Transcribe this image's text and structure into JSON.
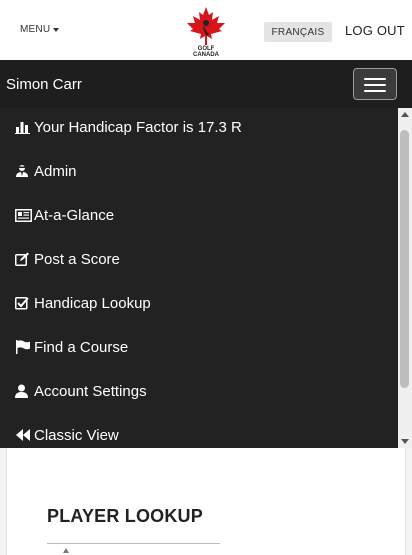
{
  "header": {
    "menu_label": "MENU",
    "logo_text_line1": "GOLF",
    "logo_text_line2": "CANADA",
    "language_button": "FRANÇAIS",
    "logout_label": "LOG OUT"
  },
  "navbar": {
    "user_name": "Simon Carr"
  },
  "menu": {
    "items": [
      {
        "label": "Your Handicap Factor is 17.3 R",
        "icon": "bar-chart-icon"
      },
      {
        "label": "Admin",
        "icon": "user-secret-icon"
      },
      {
        "label": "At-a-Glance",
        "icon": "newspaper-icon"
      },
      {
        "label": "Post a Score",
        "icon": "edit-icon"
      },
      {
        "label": "Handicap Lookup",
        "icon": "check-square-icon"
      },
      {
        "label": "Find a Course",
        "icon": "flag-icon"
      },
      {
        "label": "Account Settings",
        "icon": "user-icon"
      },
      {
        "label": "Classic View",
        "icon": "backward-icon"
      }
    ]
  },
  "main": {
    "section_title": "PLAYER LOOKUP"
  },
  "colors": {
    "navbar_bg": "#1e1e1e",
    "menu_bg": "#222222",
    "logo_red": "#d7141a"
  }
}
